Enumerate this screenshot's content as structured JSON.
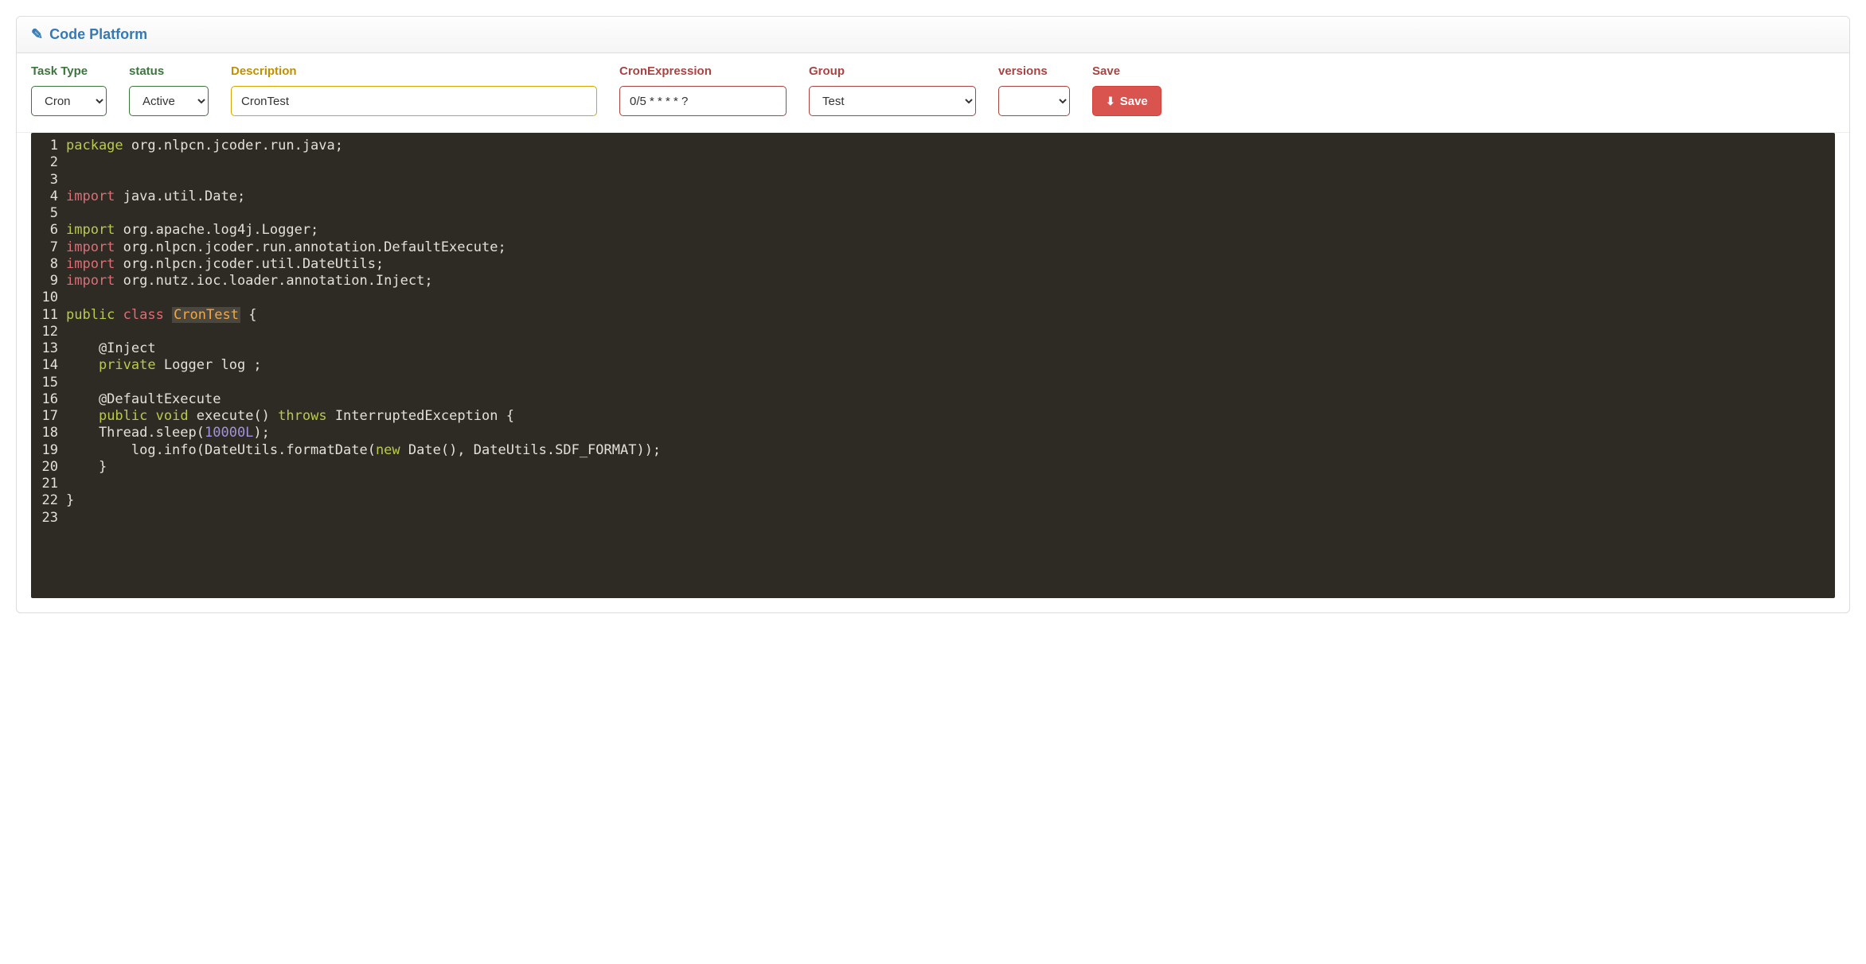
{
  "header": {
    "title": "Code Platform",
    "edit_icon": "✎"
  },
  "toolbar": {
    "task_type": {
      "label": "Task Type",
      "value": "Cron",
      "options": [
        "Cron"
      ]
    },
    "status": {
      "label": "status",
      "value": "Active",
      "options": [
        "Active"
      ]
    },
    "description": {
      "label": "Description",
      "value": "CronTest"
    },
    "cron_expression": {
      "label": "CronExpression",
      "value": "0/5 * * * * ?"
    },
    "group": {
      "label": "Group",
      "value": "Test",
      "options": [
        "Test"
      ]
    },
    "versions": {
      "label": "versions",
      "value": "",
      "options": []
    },
    "save": {
      "label": "Save",
      "btn": "Save",
      "icon": "⬇"
    }
  },
  "code_lines": [
    {
      "n": 1,
      "segments": [
        [
          "kw",
          "package "
        ],
        [
          "plain",
          "org.nlpcn.jcoder.run.java;"
        ]
      ]
    },
    {
      "n": 2,
      "segments": []
    },
    {
      "n": 3,
      "segments": []
    },
    {
      "n": 4,
      "segments": [
        [
          "kw-red",
          "import "
        ],
        [
          "plain",
          "java.util.Date;"
        ]
      ]
    },
    {
      "n": 5,
      "segments": []
    },
    {
      "n": 6,
      "segments": [
        [
          "kw",
          "import "
        ],
        [
          "plain",
          "org.apache.log4j.Logger;"
        ]
      ]
    },
    {
      "n": 7,
      "segments": [
        [
          "kw-red",
          "import "
        ],
        [
          "plain",
          "org.nlpcn.jcoder.run.annotation.DefaultExecute;"
        ]
      ]
    },
    {
      "n": 8,
      "segments": [
        [
          "kw-red",
          "import "
        ],
        [
          "plain",
          "org.nlpcn.jcoder.util.DateUtils;"
        ]
      ]
    },
    {
      "n": 9,
      "segments": [
        [
          "kw-red",
          "import "
        ],
        [
          "plain",
          "org.nutz.ioc.loader.annotation.Inject;"
        ]
      ]
    },
    {
      "n": 10,
      "segments": []
    },
    {
      "n": 11,
      "segments": [
        [
          "kw",
          "public "
        ],
        [
          "kw-red",
          "class "
        ],
        [
          "type",
          "CronTest"
        ],
        [
          "plain",
          " {"
        ]
      ]
    },
    {
      "n": 12,
      "segments": []
    },
    {
      "n": 13,
      "segments": [
        [
          "plain",
          "    @Inject"
        ]
      ]
    },
    {
      "n": 14,
      "segments": [
        [
          "plain",
          "    "
        ],
        [
          "kw",
          "private "
        ],
        [
          "plain",
          "Logger log ;"
        ]
      ]
    },
    {
      "n": 15,
      "segments": []
    },
    {
      "n": 16,
      "segments": [
        [
          "plain",
          "    @DefaultExecute"
        ]
      ]
    },
    {
      "n": 17,
      "segments": [
        [
          "plain",
          "    "
        ],
        [
          "kw",
          "public "
        ],
        [
          "kw",
          "void "
        ],
        [
          "plain",
          "execute() "
        ],
        [
          "kw",
          "throws "
        ],
        [
          "plain",
          "InterruptedException {"
        ]
      ]
    },
    {
      "n": 18,
      "segments": [
        [
          "plain",
          "    Thread.sleep("
        ],
        [
          "num",
          "10000L"
        ],
        [
          "plain",
          ");"
        ]
      ]
    },
    {
      "n": 19,
      "segments": [
        [
          "plain",
          "        log.info(DateUtils.formatDate("
        ],
        [
          "kw",
          "new "
        ],
        [
          "plain",
          "Date(), DateUtils.SDF_FORMAT));"
        ]
      ]
    },
    {
      "n": 20,
      "segments": [
        [
          "plain",
          "    }"
        ]
      ]
    },
    {
      "n": 21,
      "segments": []
    },
    {
      "n": 22,
      "segments": [
        [
          "plain",
          "}"
        ]
      ]
    },
    {
      "n": 23,
      "segments": []
    }
  ]
}
